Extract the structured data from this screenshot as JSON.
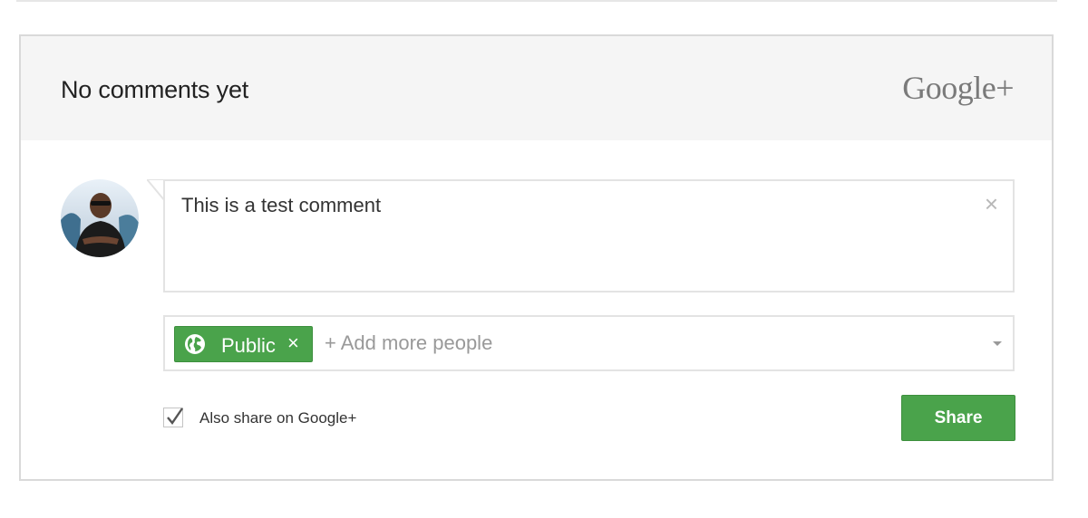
{
  "header": {
    "title": "No comments yet",
    "brand": "Google+"
  },
  "comment": {
    "value": "This is a test comment",
    "clear_icon": "close-icon"
  },
  "audience": {
    "chip_label": "Public",
    "chip_icon": "globe-icon",
    "chip_remove": "×",
    "placeholder": "+ Add more people"
  },
  "options": {
    "also_share_label": "Also share on Google+",
    "also_share_checked": true
  },
  "actions": {
    "share_label": "Share"
  },
  "colors": {
    "accent": "#4aa34b",
    "header_bg": "#f5f5f5",
    "border": "#d9d9d9"
  }
}
